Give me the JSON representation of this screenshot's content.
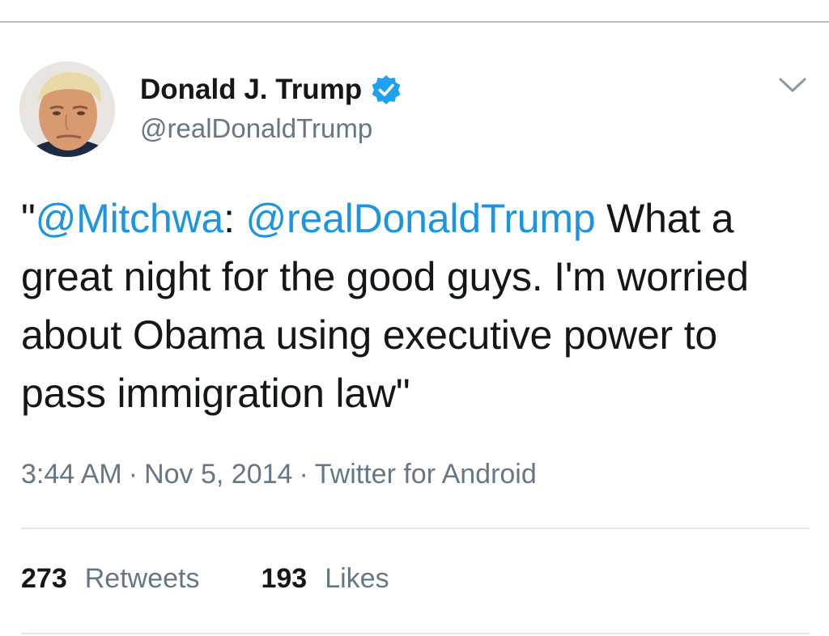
{
  "user": {
    "display_name": "Donald J. Trump",
    "handle": "@realDonaldTrump",
    "verified": true,
    "avatar": "profile-photo"
  },
  "tweet": {
    "quote_open": "\"",
    "mention_1": "@Mitchwa",
    "colon": ": ",
    "mention_2": "@realDonaldTrump",
    "body": " What a great night for the good guys. I'm worried about Obama using executive power to pass immigration law\""
  },
  "meta": {
    "time": "3:44 AM",
    "separator": "·",
    "date": "Nov 5, 2014",
    "source": "Twitter for Android"
  },
  "stats": {
    "retweets_count": "273",
    "retweets_label": "Retweets",
    "likes_count": "193",
    "likes_label": "Likes"
  },
  "icons": {
    "verified": "verified-badge-icon",
    "more": "chevron-down-icon"
  },
  "colors": {
    "link": "#1b95e0",
    "secondary_text": "#657786",
    "primary_text": "#14171a",
    "verified": "#1da1f2"
  }
}
